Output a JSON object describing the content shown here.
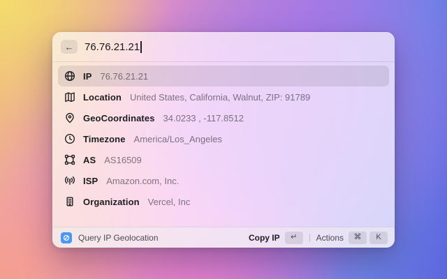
{
  "window": {
    "search": {
      "back_label": "←",
      "value": "76.76.21.21"
    },
    "rows": [
      {
        "icon": "globe-icon",
        "label": "IP",
        "value": "76.76.21.21",
        "selected": true
      },
      {
        "icon": "map-icon",
        "label": "Location",
        "value": "United States, California, Walnut, ZIP: 91789",
        "selected": false
      },
      {
        "icon": "pin-icon",
        "label": "GeoCoordinates",
        "value": "34.0233 , -117.8512",
        "selected": false
      },
      {
        "icon": "clock-icon",
        "label": "Timezone",
        "value": "America/Los_Angeles",
        "selected": false
      },
      {
        "icon": "vector-square-icon",
        "label": "AS",
        "value": "AS16509",
        "selected": false
      },
      {
        "icon": "broadcast-icon",
        "label": "ISP",
        "value": "Amazon.com, Inc.",
        "selected": false
      },
      {
        "icon": "building-icon",
        "label": "Organization",
        "value": "Vercel, Inc",
        "selected": false
      }
    ],
    "footer": {
      "extension_icon": "extension-icon",
      "app_name": "Query IP Geolocation",
      "primary_action": "Copy IP",
      "primary_key": "↵",
      "actions_label": "Actions",
      "actions_key_1": "⌘",
      "actions_key_2": "K"
    }
  },
  "colors": {
    "extension_icon_blue": "#4798f7",
    "selected_row_highlight": "rgba(82,76,94,0.14)"
  }
}
